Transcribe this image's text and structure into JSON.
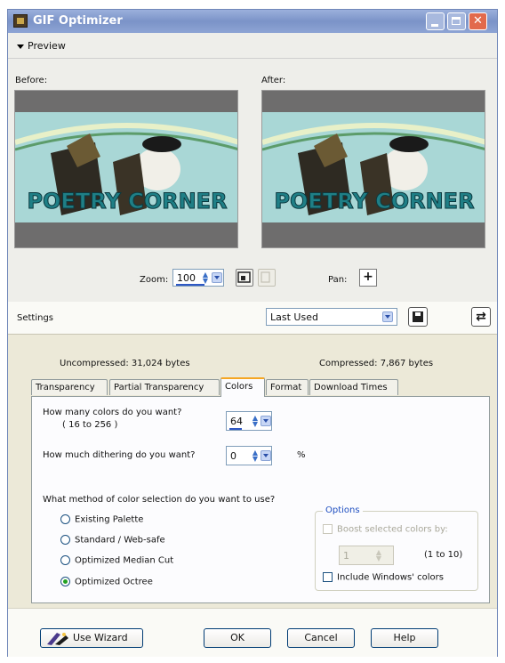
{
  "window": {
    "title": "GIF Optimizer",
    "close_glyph": "✕"
  },
  "preview": {
    "header": "Preview",
    "before_label": "Before:",
    "after_label": "After:",
    "image_text": "POETRY CORNER",
    "zoom_label": "Zoom:",
    "zoom_value": "100",
    "pan_label": "Pan:",
    "pan_glyph": "+"
  },
  "settings": {
    "label": "Settings",
    "preset_value": "Last Used",
    "swap_glyph": "⇄"
  },
  "sizes": {
    "uncompressed": "Uncompressed: 31,024 bytes",
    "compressed": "Compressed: 7,867 bytes"
  },
  "tabs": [
    {
      "label": "Transparency",
      "active": false
    },
    {
      "label": "Partial Transparency",
      "active": false
    },
    {
      "label": "Colors",
      "active": true
    },
    {
      "label": "Format",
      "active": false
    },
    {
      "label": "Download Times",
      "active": false
    }
  ],
  "colors_tab": {
    "colors_question": "How many colors do you want?",
    "colors_range": "( 16  to  256 )",
    "colors_value": "64",
    "dither_question": "How much dithering do you want?",
    "dither_value": "0",
    "dither_unit": "%",
    "method_question": "What method of color selection do you want to use?",
    "methods": [
      {
        "label": "Existing Palette",
        "selected": false
      },
      {
        "label": "Standard / Web-safe",
        "selected": false
      },
      {
        "label": "Optimized Median Cut",
        "selected": false
      },
      {
        "label": "Optimized Octree",
        "selected": true
      }
    ],
    "options": {
      "legend": "Options",
      "boost_label": "Boost selected colors by:",
      "boost_value": "1",
      "boost_range": "(1 to 10)",
      "include_windows_label": "Include Windows' colors"
    }
  },
  "buttons": {
    "wizard": "Use Wizard",
    "ok": "OK",
    "cancel": "Cancel",
    "help": "Help"
  },
  "colors": {
    "titlebar": "#7b93c8",
    "tab_accent": "#f5a623",
    "selection_blue": "#2f59c4"
  }
}
